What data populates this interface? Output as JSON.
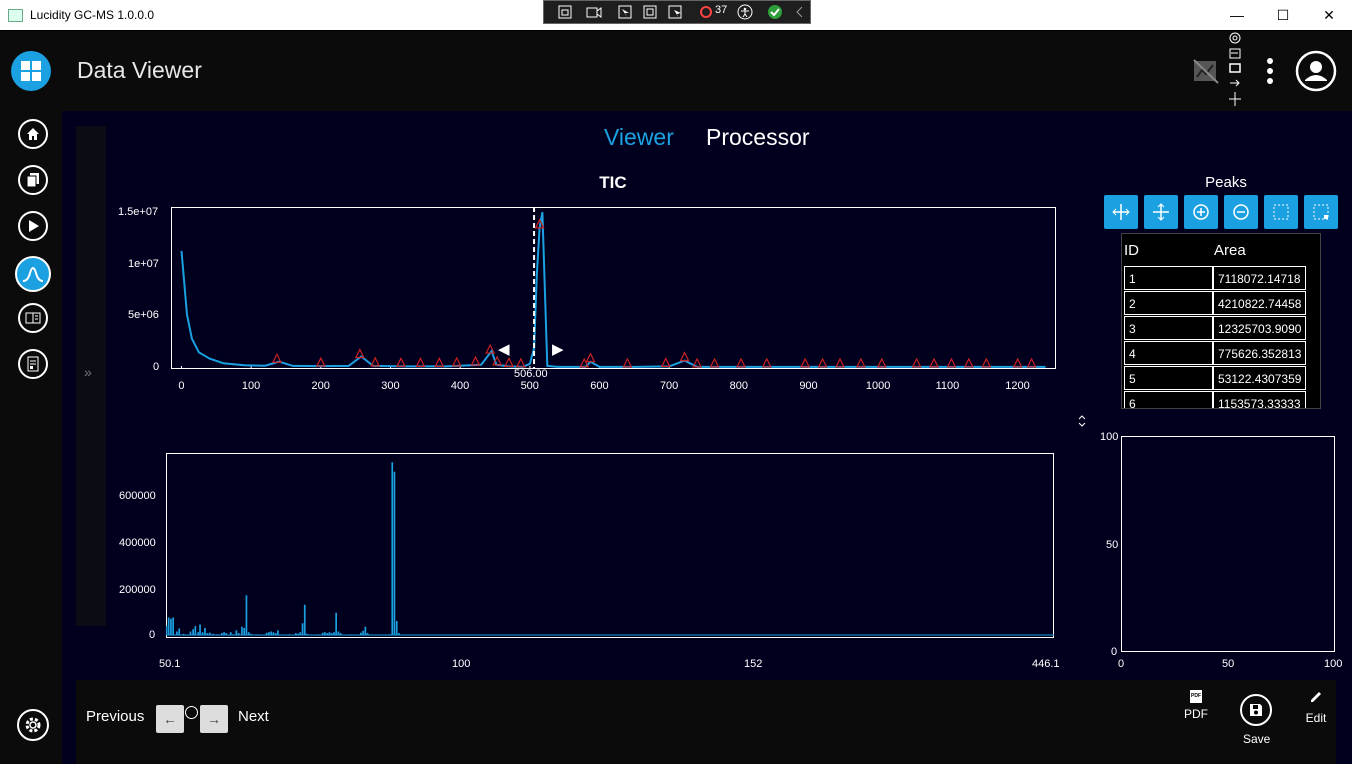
{
  "window": {
    "title": "Lucidity GC-MS 1.0.0.0",
    "minimize": "—",
    "maximize": "☐",
    "close": "✕"
  },
  "debug_toolbar": {
    "counter": "37"
  },
  "header": {
    "page_title": "Data Viewer"
  },
  "tabs": [
    {
      "label": "Viewer",
      "active": true
    },
    {
      "label": "Processor",
      "active": false
    }
  ],
  "collapse_label": "»",
  "tic_chart": {
    "title": "TIC",
    "y_ticks": [
      "1.5e+07",
      "1e+07",
      "5e+06",
      "0"
    ],
    "x_ticks": [
      "0",
      "100",
      "200",
      "300",
      "400",
      "500",
      "600",
      "700",
      "800",
      "900",
      "1000",
      "1100",
      "1200"
    ],
    "cursor_label": "506.00",
    "nav_left": "◀",
    "nav_right": "▶"
  },
  "chart_data": [
    {
      "type": "line",
      "title": "TIC",
      "xlim": [
        -15,
        1255
      ],
      "ylim": [
        0,
        15500000
      ],
      "cursor_x": 506,
      "series": [
        {
          "x": [
            0,
            8,
            15,
            25,
            40,
            60,
            90,
            120,
            140,
            160,
            200,
            240,
            258,
            275,
            320,
            380,
            430,
            445,
            452,
            470,
            490,
            500,
            506,
            510,
            514,
            518,
            525,
            540,
            580,
            587,
            600,
            650,
            700,
            722,
            740,
            800,
            900,
            1000,
            1100,
            1200,
            1240
          ],
          "y": [
            11300000,
            5200000,
            2900000,
            1600000,
            1000000,
            550000,
            350000,
            320000,
            700000,
            300000,
            280000,
            300000,
            1200000,
            300000,
            250000,
            250000,
            400000,
            1700000,
            400000,
            250000,
            200000,
            500000,
            2000000,
            9000000,
            13500000,
            15000000,
            300000,
            200000,
            200000,
            700000,
            200000,
            200000,
            250000,
            800000,
            200000,
            200000,
            200000,
            200000,
            200000,
            200000,
            200000
          ]
        }
      ],
      "peak_markers_x": [
        137,
        200,
        256,
        278,
        315,
        343,
        370,
        395,
        422,
        443,
        453,
        470,
        487,
        514,
        578,
        587,
        640,
        695,
        722,
        740,
        765,
        803,
        840,
        895,
        920,
        945,
        975,
        1005,
        1055,
        1080,
        1105,
        1130,
        1155,
        1200,
        1220
      ]
    },
    {
      "type": "bar",
      "title": "",
      "xlim": [
        50.1,
        446.1
      ],
      "ylim": [
        0,
        780000
      ],
      "x_ticks": [
        "50.1",
        "100",
        "152",
        "446.1"
      ],
      "y_ticks": [
        "600000",
        "400000",
        "200000",
        "0"
      ],
      "bars": [
        {
          "x": 50.3,
          "y": 40000
        },
        {
          "x": 51.3,
          "y": 75000
        },
        {
          "x": 52.3,
          "y": 70000
        },
        {
          "x": 53.3,
          "y": 75000
        },
        {
          "x": 55,
          "y": 15000
        },
        {
          "x": 56,
          "y": 28000
        },
        {
          "x": 58,
          "y": 5000
        },
        {
          "x": 62,
          "y": 3000
        },
        {
          "x": 61,
          "y": 15000
        },
        {
          "x": 62.2,
          "y": 25000
        },
        {
          "x": 63.2,
          "y": 38000
        },
        {
          "x": 64.5,
          "y": 12000
        },
        {
          "x": 65.3,
          "y": 45000
        },
        {
          "x": 66.4,
          "y": 12000
        },
        {
          "x": 67.5,
          "y": 30000
        },
        {
          "x": 68.6,
          "y": 8000
        },
        {
          "x": 69.7,
          "y": 10000
        },
        {
          "x": 71,
          "y": 5000
        },
        {
          "x": 73,
          "y": 3000
        },
        {
          "x": 75,
          "y": 8000
        },
        {
          "x": 76,
          "y": 12000
        },
        {
          "x": 77,
          "y": 8000
        },
        {
          "x": 79,
          "y": 12000
        },
        {
          "x": 80,
          "y": 3000
        },
        {
          "x": 81.5,
          "y": 20000
        },
        {
          "x": 82.5,
          "y": 8000
        },
        {
          "x": 84,
          "y": 35000
        },
        {
          "x": 85,
          "y": 30000
        },
        {
          "x": 86,
          "y": 170000
        },
        {
          "x": 87,
          "y": 12000
        },
        {
          "x": 88,
          "y": 5000
        },
        {
          "x": 91,
          "y": 3000
        },
        {
          "x": 95,
          "y": 10000
        },
        {
          "x": 96,
          "y": 12000
        },
        {
          "x": 97,
          "y": 15000
        },
        {
          "x": 98,
          "y": 12000
        },
        {
          "x": 99,
          "y": 8000
        },
        {
          "x": 100,
          "y": 20000
        },
        {
          "x": 105,
          "y": 3000
        },
        {
          "x": 108,
          "y": 8000
        },
        {
          "x": 109,
          "y": 5000
        },
        {
          "x": 110,
          "y": 12000
        },
        {
          "x": 111,
          "y": 50000
        },
        {
          "x": 112,
          "y": 130000
        },
        {
          "x": 113,
          "y": 5000
        },
        {
          "x": 118,
          "y": 3000
        },
        {
          "x": 120,
          "y": 10000
        },
        {
          "x": 121,
          "y": 12000
        },
        {
          "x": 122,
          "y": 8000
        },
        {
          "x": 123,
          "y": 12000
        },
        {
          "x": 124,
          "y": 8000
        },
        {
          "x": 125,
          "y": 12000
        },
        {
          "x": 126,
          "y": 95000
        },
        {
          "x": 127,
          "y": 15000
        },
        {
          "x": 128,
          "y": 8000
        },
        {
          "x": 133,
          "y": 3000
        },
        {
          "x": 137,
          "y": 10000
        },
        {
          "x": 138,
          "y": 18000
        },
        {
          "x": 139,
          "y": 35000
        },
        {
          "x": 140,
          "y": 8000
        },
        {
          "x": 150,
          "y": 3000
        },
        {
          "x": 151,
          "y": 740000
        },
        {
          "x": 152,
          "y": 700000
        },
        {
          "x": 153,
          "y": 60000
        },
        {
          "x": 154,
          "y": 8000
        }
      ]
    },
    {
      "type": "scatter",
      "title": "",
      "xlim": [
        0,
        100
      ],
      "ylim": [
        0,
        100
      ],
      "x_ticks": [
        "0",
        "50",
        "100"
      ],
      "y_ticks": [
        "100",
        "50",
        "0"
      ],
      "points": []
    }
  ],
  "peaks_panel": {
    "title": "Peaks",
    "columns": [
      "ID",
      "Area"
    ],
    "rows": [
      [
        "1",
        "7118072.14718"
      ],
      [
        "2",
        "4210822.74458"
      ],
      [
        "3",
        "12325703.9090"
      ],
      [
        "4",
        "775626.352813"
      ],
      [
        "5",
        "53122.4307359"
      ],
      [
        "6",
        "1153573.33333"
      ]
    ]
  },
  "splitter_glyph": "⌃⌄",
  "footer": {
    "previous_label": "Previous",
    "next_label": "Next",
    "prev_arrow": "←",
    "next_arrow": "→",
    "pdf_icon_text": "PDF",
    "pdf_label": "PDF",
    "save_label": "Save",
    "edit_label": "Edit"
  },
  "colors": {
    "accent": "#1ba1e2",
    "background": "#00001e",
    "chrome": "#0b0b0b",
    "marker": "#cc2222"
  }
}
